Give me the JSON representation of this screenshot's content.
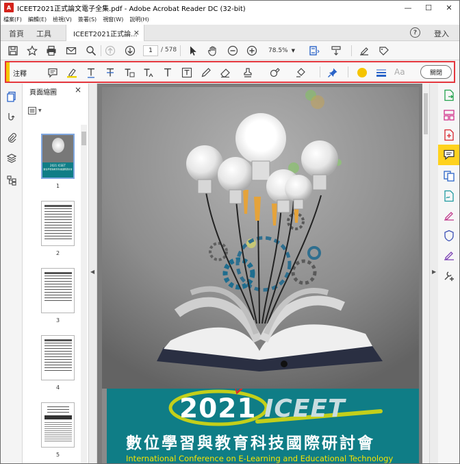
{
  "window": {
    "title": "ICEET2021正式論文電子全集.pdf - Adobe Acrobat Reader DC (32-bit)",
    "app_icon": "acrobat-icon",
    "controls": [
      "minimize-icon",
      "maximize-icon",
      "close-icon"
    ]
  },
  "menu": {
    "items": [
      "檔案(F)",
      "編輯(E)",
      "檢視(V)",
      "簽署(S)",
      "視窗(W)",
      "說明(H)"
    ]
  },
  "tabs": {
    "home": "首頁",
    "tools": "工具",
    "document": "ICEET2021正式論...",
    "close": "×",
    "help": "?",
    "login": "登入"
  },
  "toolbar": {
    "page_current": "1",
    "page_total": "/ 578",
    "zoom": "78.5%",
    "icons": [
      "save-icon",
      "star-icon",
      "print-icon",
      "mail-icon",
      "search-icon",
      "page-up-icon",
      "page-down-icon",
      "select-cursor-icon",
      "hand-icon",
      "zoom-out-icon",
      "zoom-in-icon",
      "fit-page-icon",
      "scroll-mode-icon",
      "sign-icon",
      "redact-icon"
    ]
  },
  "annotation_bar": {
    "label": "注釋",
    "close_label": "關閉",
    "aa": "Aa",
    "color": "#f5c400",
    "tools": [
      "sticky-note-icon",
      "highlighter-icon",
      "underline-text-icon",
      "strikethrough-text-icon",
      "replace-text-icon",
      "insert-text-icon",
      "add-text-icon",
      "text-box-icon",
      "pencil-icon",
      "eraser-icon",
      "stamp-icon",
      "attach-icon",
      "shapes-icon",
      "pin-icon"
    ]
  },
  "left_rail": {
    "icons": [
      "page-thumbnails-icon",
      "link-icon",
      "attachment-icon",
      "layers-icon",
      "structure-icon"
    ]
  },
  "thumbnails": {
    "title": "頁面縮圖",
    "close": "×",
    "pages": [
      "1",
      "2",
      "3",
      "4",
      "5"
    ],
    "page1_lines": [
      "2021 ICEET",
      "數位學習與教育科技國際研討會"
    ]
  },
  "document": {
    "cover": {
      "year": "2021",
      "brand": "ICEET",
      "title_zh": "數位學習與教育科技國際研討會",
      "title_en": "International Conference on E-Learning and Educational Technology"
    }
  },
  "right_rail": {
    "icons": [
      "export-pdf-icon",
      "organize-pages-icon",
      "create-pdf-icon",
      "comment-icon",
      "combine-files-icon",
      "fill-sign-icon",
      "send-for-signature-icon",
      "protect-icon",
      "edit-icon",
      "more-tools-icon"
    ],
    "active": "comment-icon",
    "active_color": "#ffd21e"
  },
  "colors": {
    "accent_red": "#e4363d",
    "annotation_yellow": "#f6c700",
    "banner_teal": "#0f7d86",
    "subtitle_yellow": "#f6e400"
  }
}
